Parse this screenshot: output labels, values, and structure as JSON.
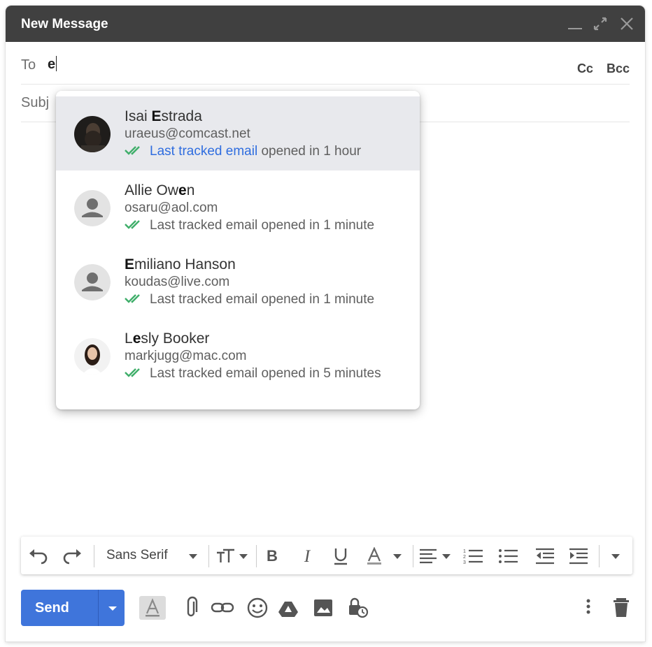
{
  "window": {
    "title": "New Message"
  },
  "to": {
    "label": "To",
    "value": "e"
  },
  "cc_label": "Cc",
  "bcc_label": "Bcc",
  "subject": {
    "label": "Subj"
  },
  "suggestions": [
    {
      "name_pre": "Isai ",
      "name_bold": "E",
      "name_post": "strada",
      "email": "uraeus@comcast.net",
      "status_link": "Last tracked email",
      "status_rest": " opened in 1 hour",
      "avatar": "photo-man"
    },
    {
      "name_pre": "Allie Ow",
      "name_bold": "e",
      "name_post": "n",
      "email": "osaru@aol.com",
      "status_link": "",
      "status_rest": "Last tracked email opened in 1 minute",
      "avatar": "placeholder"
    },
    {
      "name_pre": "",
      "name_bold": "E",
      "name_post": "miliano Hanson",
      "email": "koudas@live.com",
      "status_link": "",
      "status_rest": "Last tracked email opened in 1 minute",
      "avatar": "placeholder"
    },
    {
      "name_pre": "L",
      "name_bold": "e",
      "name_post": "sly Booker",
      "email": "markjugg@mac.com",
      "status_link": "",
      "status_rest": "Last tracked email opened in 5 minutes",
      "avatar": "photo-woman"
    }
  ],
  "toolbar": {
    "font": "Sans Serif"
  },
  "send": {
    "label": "Send"
  },
  "colors": {
    "accent": "#3f75db",
    "link": "#2f6ddf",
    "check": "#3fae6a",
    "titlebar": "#404040",
    "highlight": "#e8e9ed"
  }
}
